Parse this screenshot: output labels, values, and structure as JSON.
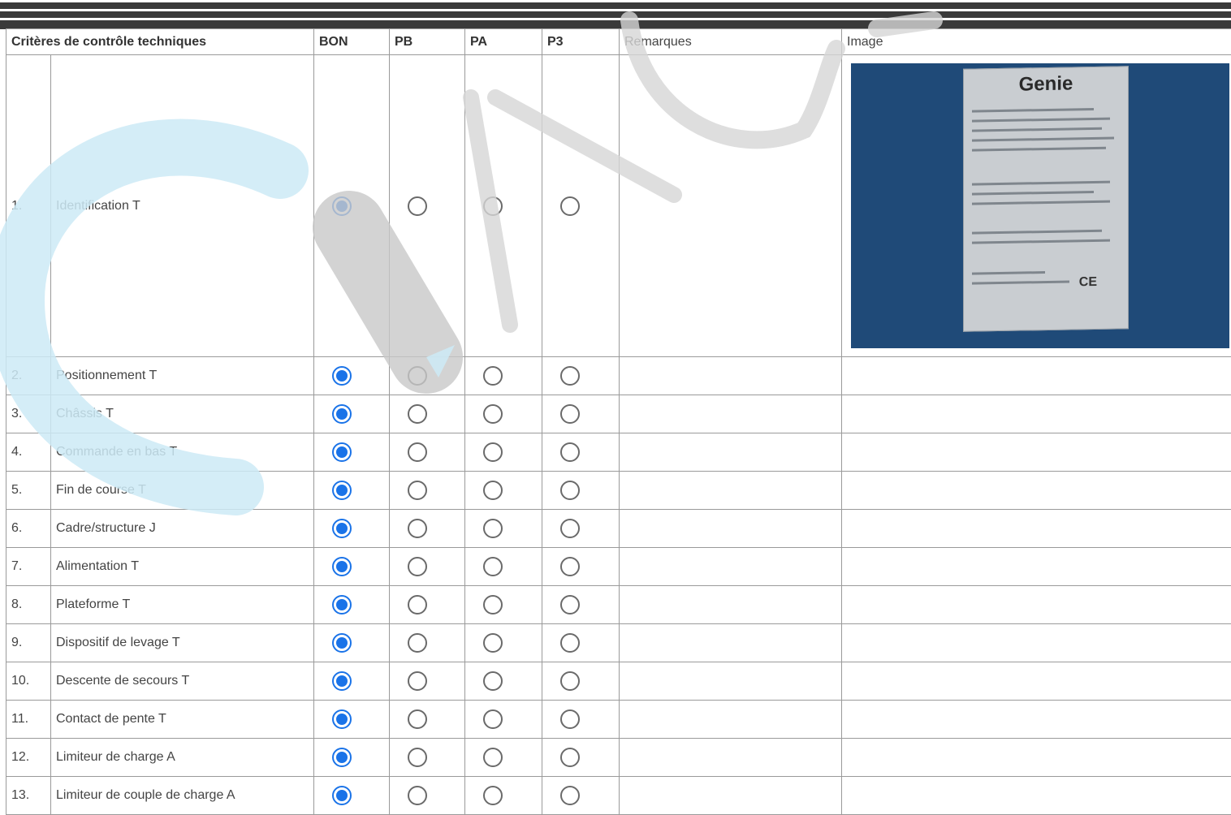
{
  "headers": {
    "criteria": "Critères de contrôle techniques",
    "bon": "BON",
    "pb": "PB",
    "pa": "PA",
    "p3": "P3",
    "remarks": "Remarques",
    "image": "Image"
  },
  "image": {
    "brand": "Genie",
    "mark": "CE"
  },
  "rows": [
    {
      "num": "1.",
      "label": "Identification T",
      "selected": "BON"
    },
    {
      "num": "2.",
      "label": "Positionnement T",
      "selected": "BON"
    },
    {
      "num": "3.",
      "label": "Châssis T",
      "selected": "BON"
    },
    {
      "num": "4.",
      "label": "Commande en bas T",
      "selected": "BON"
    },
    {
      "num": "5.",
      "label": "Fin de course T",
      "selected": "BON"
    },
    {
      "num": "6.",
      "label": "Cadre/structure J",
      "selected": "BON"
    },
    {
      "num": "7.",
      "label": "Alimentation T",
      "selected": "BON"
    },
    {
      "num": "8.",
      "label": "Plateforme T",
      "selected": "BON"
    },
    {
      "num": "9.",
      "label": "Dispositif de levage T",
      "selected": "BON"
    },
    {
      "num": "10.",
      "label": "Descente de secours T",
      "selected": "BON"
    },
    {
      "num": "11.",
      "label": "Contact de pente T",
      "selected": "BON"
    },
    {
      "num": "12.",
      "label": "Limiteur de charge A",
      "selected": "BON"
    },
    {
      "num": "13.",
      "label": "Limiteur de couple de charge A",
      "selected": "BON"
    }
  ],
  "colors": {
    "radio_checked": "#1a73e8",
    "watermark_cyan": "#cdeaf6",
    "watermark_gray": "#c8c8c8"
  }
}
